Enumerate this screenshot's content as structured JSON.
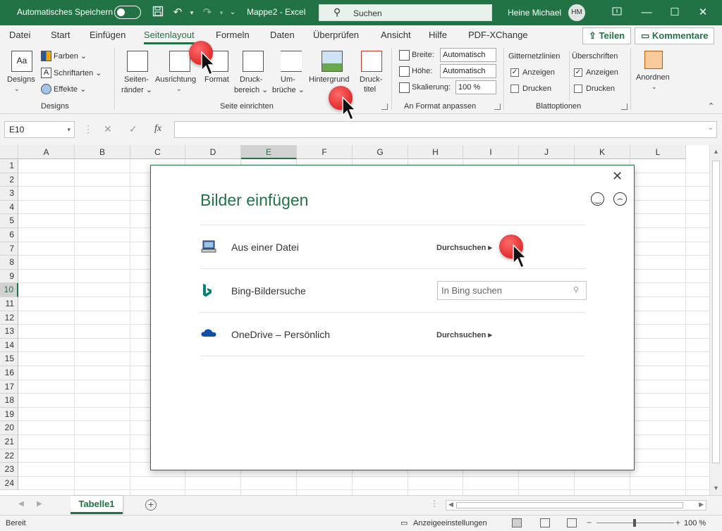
{
  "titlebar": {
    "autosave_label": "Automatisches Speichern",
    "document_title": "Mappe2  -  Excel",
    "search_placeholder": "Suchen",
    "user_name": "Heine Michael",
    "user_initials": "HM"
  },
  "ribbon_tabs": [
    "Datei",
    "Start",
    "Einfügen",
    "Seitenlayout",
    "Formeln",
    "Daten",
    "Überprüfen",
    "Ansicht",
    "Hilfe",
    "PDF-XChange"
  ],
  "active_tab": "Seitenlayout",
  "share_buttons": {
    "share": "Teilen",
    "comments": "Kommentare"
  },
  "ribbon": {
    "designs": {
      "designs_label": "Designs",
      "colors": "Farben",
      "fonts": "Schriftarten",
      "effects": "Effekte",
      "group_label": "Designs"
    },
    "page_setup": {
      "margins_l1": "Seiten-",
      "margins_l2": "ränder",
      "orientation": "Ausrichtung",
      "format": "Format",
      "print_area_l1": "Druck-",
      "print_area_l2": "bereich",
      "breaks_l1": "Um-",
      "breaks_l2": "brüche",
      "background": "Hintergrund",
      "print_titles_l1": "Druck-",
      "print_titles_l2": "titel",
      "group_label": "Seite einrichten"
    },
    "scale_to_fit": {
      "width_label": "Breite:",
      "width_value": "Automatisch",
      "height_label": "Höhe:",
      "height_value": "Automatisch",
      "scale_label": "Skalierung:",
      "scale_value": "100 %",
      "group_label": "An Format anpassen"
    },
    "sheet_options": {
      "gridlines_label": "Gitternetzlinien",
      "gridlines_view": "Anzeigen",
      "gridlines_print": "Drucken",
      "headings_label": "Überschriften",
      "headings_view": "Anzeigen",
      "headings_print": "Drucken",
      "group_label": "Blattoptionen"
    },
    "arrange": {
      "label": "Anordnen"
    }
  },
  "formula_bar": {
    "name_box": "E10",
    "cancel": "✕",
    "enter": "✓",
    "fx": "fx"
  },
  "grid": {
    "columns": [
      "A",
      "B",
      "C",
      "D",
      "E",
      "F",
      "G",
      "H",
      "I",
      "J",
      "K",
      "L"
    ],
    "rows": [
      "1",
      "2",
      "3",
      "4",
      "5",
      "6",
      "7",
      "8",
      "9",
      "10",
      "11",
      "12",
      "13",
      "14",
      "15",
      "16",
      "17",
      "18",
      "19",
      "20",
      "21",
      "22",
      "23",
      "24"
    ],
    "selected_column": "E",
    "selected_row": "10"
  },
  "dialog": {
    "title": "Bilder einfügen",
    "close": "✕",
    "rows": [
      {
        "label": "Aus einer Datei",
        "action": "Durchsuchen"
      },
      {
        "label": "Bing-Bildersuche",
        "search_placeholder": "In Bing suchen"
      },
      {
        "label": "OneDrive – Persönlich",
        "action": "Durchsuchen"
      }
    ]
  },
  "sheets": {
    "active": "Tabelle1"
  },
  "statusbar": {
    "ready": "Bereit",
    "display_settings": "Anzeigeeinstellungen",
    "zoom": "100 %"
  },
  "colors": {
    "excel_green": "#217346",
    "marker_red": "#e02b2b"
  }
}
